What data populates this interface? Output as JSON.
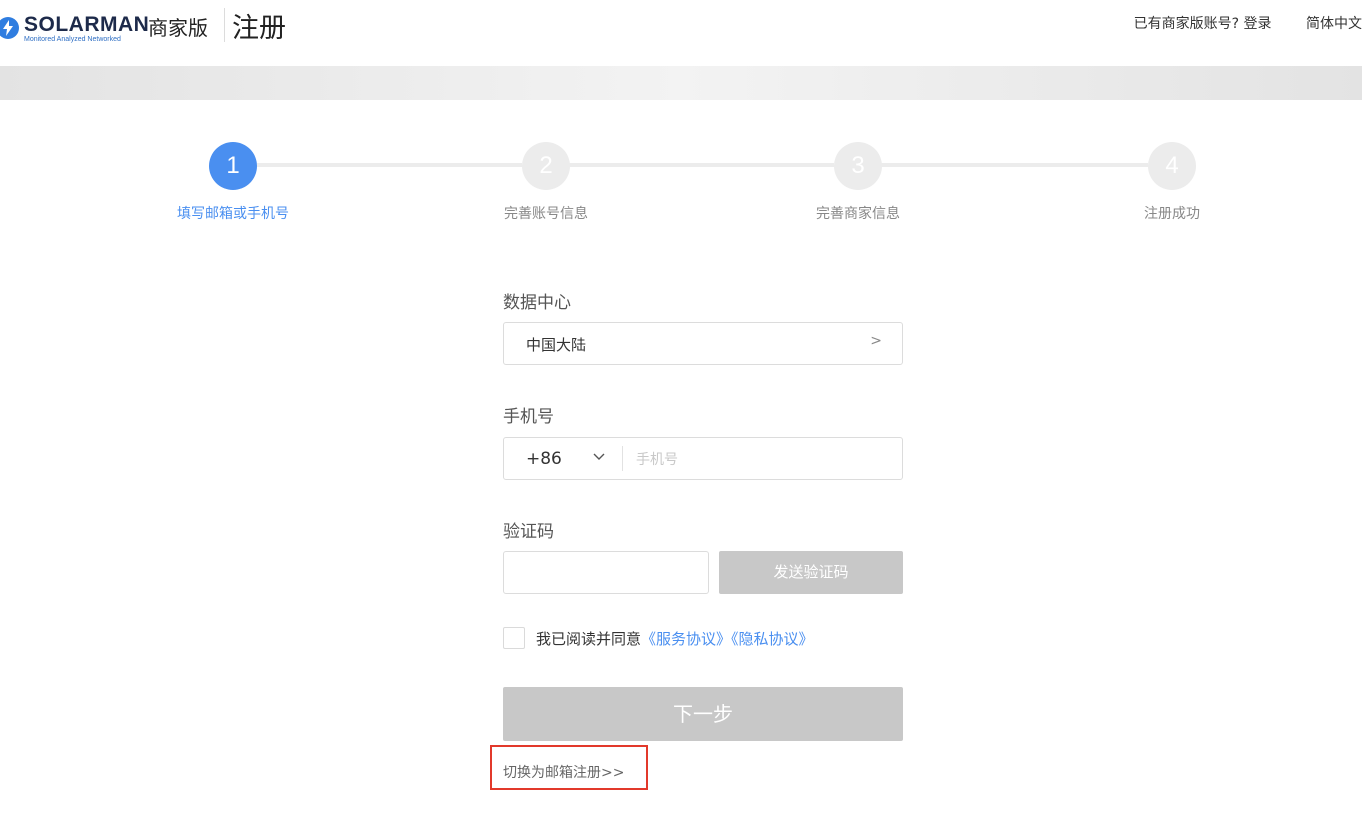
{
  "header": {
    "brand": "SOLARMAN",
    "tagline": "Monitored Analyzed Networked",
    "edition": "商家版",
    "page_title": "注册",
    "login_prompt": "已有商家版账号? 登录",
    "language": "简体中文"
  },
  "steps": [
    {
      "number": "1",
      "label": "填写邮箱或手机号",
      "active": true
    },
    {
      "number": "2",
      "label": "完善账号信息",
      "active": false
    },
    {
      "number": "3",
      "label": "完善商家信息",
      "active": false
    },
    {
      "number": "4",
      "label": "注册成功",
      "active": false
    }
  ],
  "form": {
    "data_center_label": "数据中心",
    "data_center_value": "中国大陆",
    "data_center_chevron": ">",
    "phone_label": "手机号",
    "country_code": "+86",
    "phone_placeholder": "手机号",
    "verify_label": "验证码",
    "verify_value": "",
    "send_code_button": "发送验证码",
    "agree_text": "我已阅读并同意",
    "service_agreement": "《服务协议》",
    "privacy_agreement": "《隐私协议》",
    "next_button": "下一步",
    "switch_link": "切换为邮箱注册>>"
  },
  "colors": {
    "accent": "#4a8ff0",
    "disabled": "#c8c8c8",
    "highlight_border": "#e2392b"
  }
}
